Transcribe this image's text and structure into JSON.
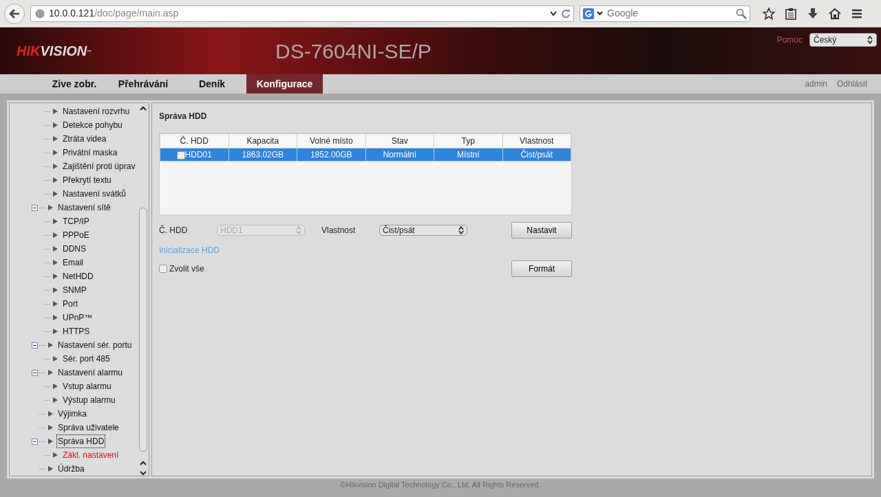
{
  "browser": {
    "url": {
      "host": "10.0.0.121",
      "path": "/doc/page/main.asp"
    },
    "search": {
      "placeholder": "Google"
    }
  },
  "header": {
    "logo": {
      "part1": "HIK",
      "part2": "VISION",
      "mark": "™"
    },
    "model": "DS-7604NI-SE/P",
    "help": "Pomoc",
    "language": "Český"
  },
  "nav": {
    "tabs": [
      {
        "label": "Zive zobr.",
        "selected": false
      },
      {
        "label": "Přehrávání",
        "selected": false
      },
      {
        "label": "Deník",
        "selected": false
      },
      {
        "label": "Konfigurace",
        "selected": true
      }
    ],
    "user": "admin",
    "logout": "Odhlásit"
  },
  "tree": [
    {
      "children": [
        {
          "label": "Nastavení rozvrhu",
          "selected": false,
          "focused": false
        },
        {
          "label": "Detekce pohybu",
          "selected": false,
          "focused": false
        },
        {
          "label": "Ztráta videa",
          "selected": false,
          "focused": false
        },
        {
          "label": "Privátní maska",
          "selected": false,
          "focused": false
        },
        {
          "label": "Zajištění proti úprav",
          "selected": false,
          "focused": false
        },
        {
          "label": "Překrytí textu",
          "selected": false,
          "focused": false
        },
        {
          "label": "Nastavení svátků",
          "selected": false,
          "focused": false
        }
      ]
    },
    {
      "label": "Nastavení sítě",
      "expanded": true,
      "selected": false,
      "focused": false,
      "children": [
        {
          "label": "TCP/IP",
          "selected": false,
          "focused": false
        },
        {
          "label": "PPPoE",
          "selected": false,
          "focused": false
        },
        {
          "label": "DDNS",
          "selected": false,
          "focused": false
        },
        {
          "label": "Email",
          "selected": false,
          "focused": false
        },
        {
          "label": "NetHDD",
          "selected": false,
          "focused": false
        },
        {
          "label": "SNMP",
          "selected": false,
          "focused": false
        },
        {
          "label": "Port",
          "selected": false,
          "focused": false
        },
        {
          "label": "UPnP™",
          "selected": false,
          "focused": false
        },
        {
          "label": "HTTPS",
          "selected": false,
          "focused": false
        }
      ]
    },
    {
      "label": "Nastavení sér. portu",
      "expanded": true,
      "selected": false,
      "focused": false,
      "children": [
        {
          "label": "Sér. port 485",
          "selected": false,
          "focused": false
        }
      ]
    },
    {
      "label": "Nastavení alarmu",
      "expanded": true,
      "selected": false,
      "focused": false,
      "children": [
        {
          "label": "Vstup alarmu",
          "selected": false,
          "focused": false
        },
        {
          "label": "Výstup alarmu",
          "selected": false,
          "focused": false
        }
      ]
    },
    {
      "label": "Výjimka",
      "expanded": false,
      "selected": false,
      "focused": false
    },
    {
      "label": "Správa uživatele",
      "expanded": false,
      "selected": false,
      "focused": false
    },
    {
      "label": "Správa HDD",
      "expanded": true,
      "selected": false,
      "focused": true,
      "children": [
        {
          "label": "Zákl. nastavení",
          "selected": true,
          "focused": false
        }
      ]
    },
    {
      "label": "Údržba",
      "expanded": false,
      "selected": false,
      "focused": false
    }
  ],
  "content": {
    "title": "Správa HDD",
    "table": {
      "columns": [
        "Č. HDD",
        "Kapacita",
        "Volné místo",
        "Stav",
        "Typ",
        "Vlastnost"
      ],
      "rows": [
        {
          "selected": true,
          "checked": false,
          "cells": [
            "HDD01",
            "1863.02GB",
            "1852.00GB",
            "Normální",
            "Místní",
            "Čist/psát"
          ]
        }
      ]
    },
    "form": {
      "hdd_label": "Č. HDD",
      "hdd_value": "HDD1",
      "hdd_disabled": true,
      "property_label": "Vlastnost",
      "property_value": "Čist/psát",
      "set_button": "Nastavit",
      "init_link": "Inicializace HDD",
      "select_all": {
        "label": "Zvolit vše",
        "checked": false
      },
      "format_button": "Formát"
    }
  },
  "footer": "©Hikvision Digital Technology Co., Ltd. All Rights Reserved."
}
